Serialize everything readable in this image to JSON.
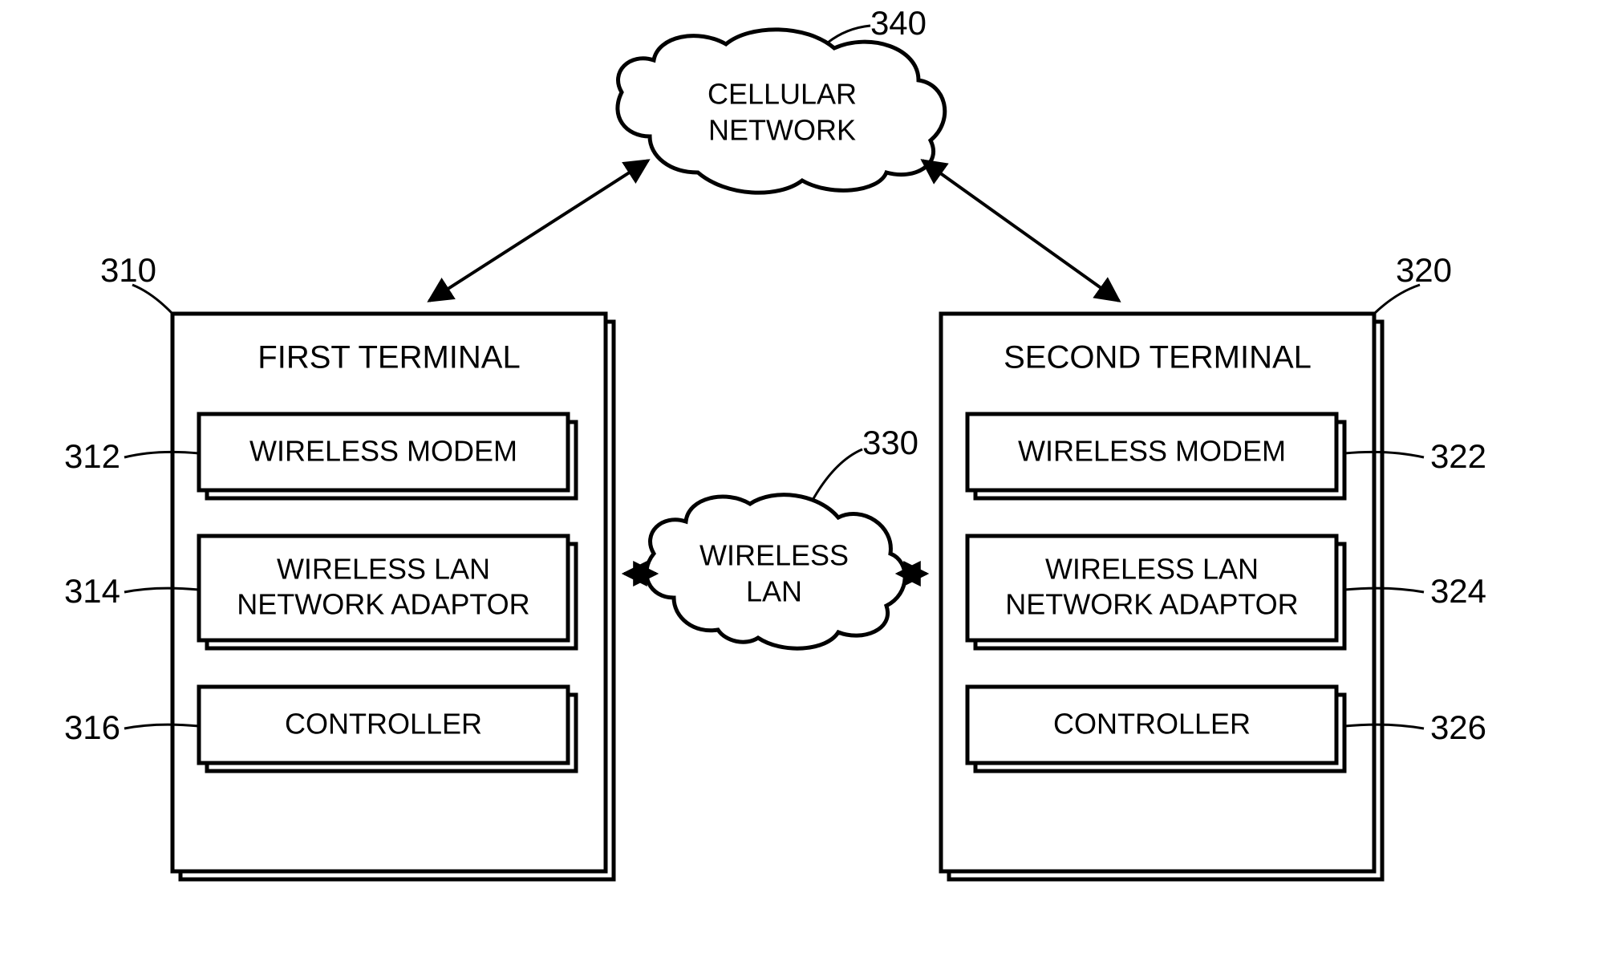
{
  "refs": {
    "cellular_ref": "340",
    "wlan_ref": "330",
    "first_term_ref": "310",
    "second_term_ref": "320",
    "r312": "312",
    "r314": "314",
    "r316": "316",
    "r322": "322",
    "r324": "324",
    "r326": "326"
  },
  "labels": {
    "cellular1": "CELLULAR",
    "cellular2": "NETWORK",
    "wlan1": "WIRELESS",
    "wlan2": "LAN",
    "first_terminal": "FIRST TERMINAL",
    "second_terminal": "SECOND TERMINAL",
    "wireless_modem": "WIRELESS MODEM",
    "wlan_adaptor1": "WIRELESS LAN",
    "wlan_adaptor2": "NETWORK ADAPTOR",
    "controller": "CONTROLLER"
  }
}
